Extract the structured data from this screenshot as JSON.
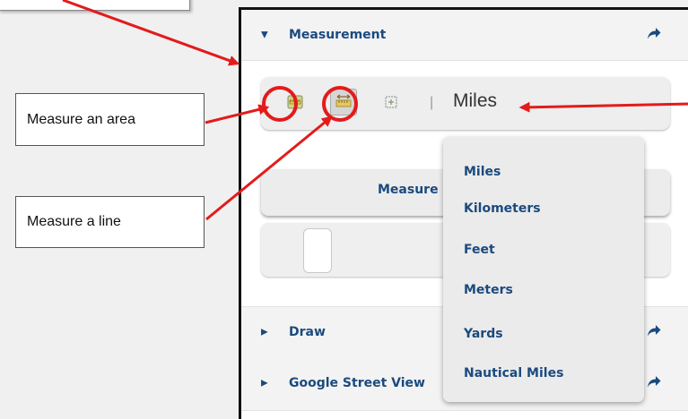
{
  "callouts": {
    "top_box_text": "",
    "area_label": "Measure an area",
    "line_label": "Measure a line"
  },
  "panel": {
    "measurement_title": "Measurement",
    "unit_label": "Miles",
    "separator": "|",
    "measure_button_label": "Measure",
    "draw_title": "Draw",
    "streetview_title": "Google Street View"
  },
  "units_dropdown": {
    "options": [
      "Miles",
      "Kilometers",
      "Feet",
      "Meters",
      "Yards",
      "Nautical Miles"
    ]
  },
  "colors": {
    "accent": "#1b4a7e",
    "annotation": "#e31b1b"
  },
  "icons": {
    "area_tool": "measure-area-icon",
    "distance_tool": "measure-distance-icon",
    "location_tool": "location-icon",
    "share": "share-arrow-icon",
    "expand": "caret-icon"
  }
}
